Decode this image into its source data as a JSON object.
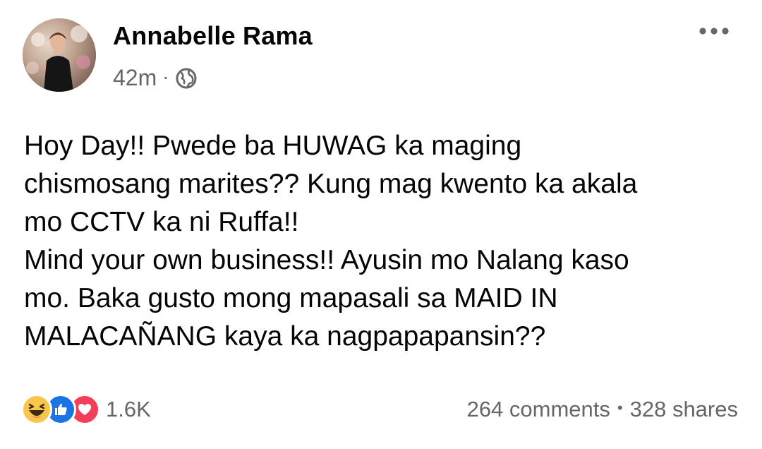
{
  "post": {
    "author_name": "Annabelle Rama",
    "timestamp": "42m",
    "meta_separator": "·",
    "privacy_icon": "globe-icon",
    "more_icon": "more-options-icon",
    "text": "Hoy Day!!  Pwede ba HUWAG ka maging\nchismosang marites?? Kung mag kwento ka akala\nmo CCTV ka ni Ruffa!!\nMind your own business!! Ayusin mo Nalang kaso\nmo. Baka gusto mong mapasali sa MAID IN\nMALACAÑANG kaya ka nagpapapansin??"
  },
  "reactions": {
    "icons": [
      "haha-icon",
      "like-icon",
      "love-icon"
    ],
    "count": "1.6K"
  },
  "engagement": {
    "comments": "264 comments",
    "separator": "•",
    "shares": "328 shares"
  },
  "colors": {
    "text_primary": "#050505",
    "text_secondary": "#65676b",
    "like_blue": "#1b74e4",
    "love_red": "#f33e58",
    "haha_yellow": "#f7c64b"
  }
}
